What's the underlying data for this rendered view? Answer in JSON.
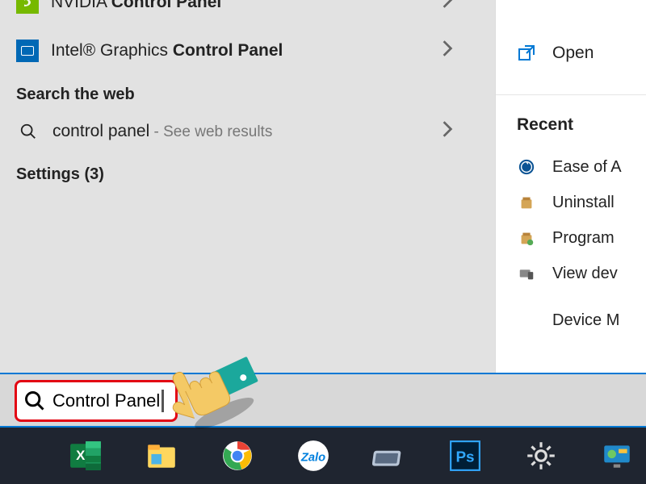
{
  "results": {
    "nvidia": {
      "prefix": "NVIDIA ",
      "bold": "Control Panel",
      "iconLetter": "n"
    },
    "intel": {
      "prefix": "Intel® Graphics ",
      "bold": "Control Panel"
    }
  },
  "sections": {
    "searchWebHeader": "Search the web",
    "webResult": {
      "query": "control panel",
      "suffix": " - See web results"
    },
    "settingsHeader": "Settings (3)"
  },
  "rightPanel": {
    "openLabel": "Open",
    "recentHeader": "Recent",
    "recentItems": {
      "easeOfAccess": "Ease of A",
      "uninstall": "Uninstall",
      "programs": "Program",
      "viewDevices": "View dev",
      "deviceManager": "Device M"
    }
  },
  "search": {
    "value": "Control Panel"
  }
}
